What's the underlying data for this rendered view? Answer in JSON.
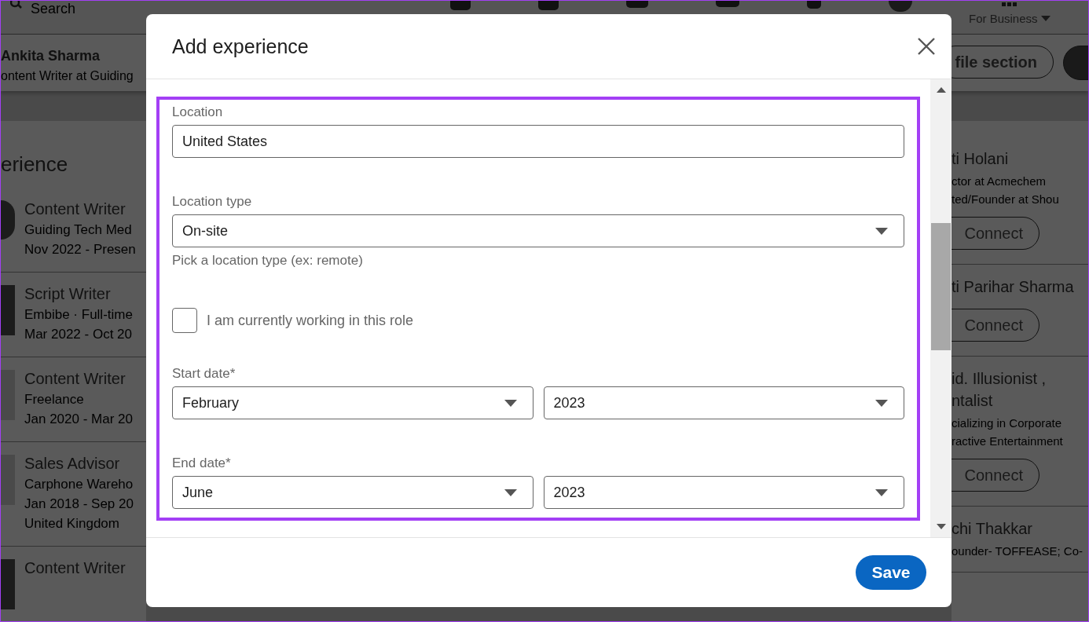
{
  "background": {
    "nav": {
      "search_placeholder": "Search",
      "business_menu": "For Business"
    },
    "profile_bar": {
      "name": "Ankita Sharma",
      "headline": "ontent Writer at Guiding",
      "section_button": "file section"
    },
    "experience": {
      "heading": "erience",
      "items": [
        {
          "title": "Content Writer",
          "company": "Guiding Tech Med",
          "dates": "Nov 2022 - Presen"
        },
        {
          "title": "Script Writer",
          "company": "Embibe · Full-time",
          "dates": "Mar 2022 - Oct 20"
        },
        {
          "title": "Content Writer",
          "company": "Freelance",
          "dates": "Jan 2020 - Mar 20"
        },
        {
          "title": "Sales Advisor",
          "company": "Carphone Wareho",
          "dates": "Jan 2018 - Sep 20",
          "location": "United Kingdom"
        },
        {
          "title": "Content Writer"
        }
      ]
    },
    "people": [
      {
        "name": "ti Holani",
        "lines": [
          "ctor at Acmechem",
          "ted/Founder at Shou"
        ],
        "button": "Connect"
      },
      {
        "name": "ti Parihar Sharma",
        "button": "Connect"
      },
      {
        "name": "id. Illusionist ,\nntalist",
        "lines": [
          "cializing in Corporate",
          "ractive Entertainment"
        ],
        "button": "Connect"
      },
      {
        "name": "chi Thakkar",
        "lines": [
          "ounder- TOFFEASE; Co-"
        ]
      }
    ]
  },
  "modal": {
    "title": "Add experience",
    "fields": [
      {
        "kind": "text",
        "label": "Location",
        "value": "United States"
      },
      {
        "kind": "select",
        "label": "Location type",
        "value": "On-site",
        "hint": "Pick a location type (ex: remote)"
      },
      {
        "kind": "checkbox",
        "label": "I am currently working in this role",
        "checked": false
      },
      {
        "kind": "date",
        "label": "Start date*",
        "month": "February",
        "year": "2023"
      },
      {
        "kind": "date",
        "label": "End date*",
        "month": "June",
        "year": "2023"
      }
    ],
    "save": "Save"
  }
}
